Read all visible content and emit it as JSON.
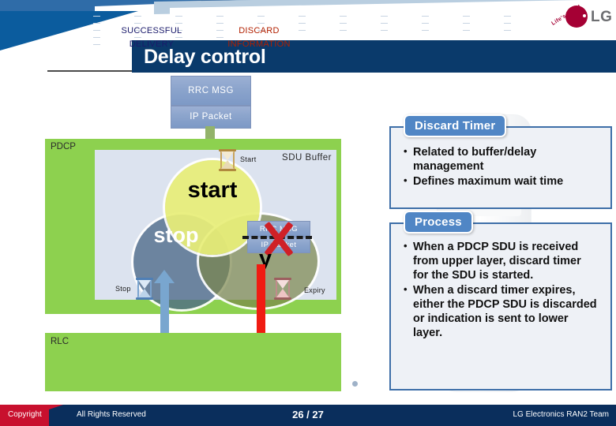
{
  "header": {
    "title": "Delay control",
    "logo": {
      "word": "LG",
      "tagline": "Life's Good"
    }
  },
  "diagram": {
    "input_boxes": [
      {
        "label": "RRC MSG"
      },
      {
        "label": "IP Packet"
      }
    ],
    "pdcp_label": "PDCP",
    "sdu_buffer_label": "SDU Buffer",
    "circles": [
      {
        "label": "start",
        "color": "#E7EE78"
      },
      {
        "label": "stop",
        "color": "#4D6988"
      },
      {
        "label": "y",
        "color": "#7A864B"
      }
    ],
    "timers": [
      {
        "label": "Start",
        "color": "#b08a3e"
      },
      {
        "label": "Stop",
        "color": "#4f7fb5"
      },
      {
        "label": "Expiry",
        "color": "#b06a6a"
      }
    ],
    "discarded_boxes": [
      {
        "label": "RRC MSG"
      },
      {
        "label": "IP Packet"
      }
    ],
    "rlc_label": "RLC",
    "outcomes": [
      {
        "line1": "SUCCESSFUL",
        "line2": "DELIVERY",
        "color": "#1a1a6b"
      },
      {
        "line1": "DISCARD",
        "line2": "INFORMATION",
        "color": "#b22000"
      }
    ]
  },
  "panels": [
    {
      "heading": "Discard Timer",
      "bullets": [
        "Related to buffer/delay management",
        "Defines maximum wait time"
      ]
    },
    {
      "heading": "Process",
      "bullets": [
        "When a PDCP SDU is received from upper layer, discard timer for the SDU is started.",
        "When a discard timer expires, either the PDCP SDU is discarded or indication is sent to lower layer."
      ]
    }
  ],
  "footer": {
    "copyright": "Copyright",
    "rights": "All Rights Reserved",
    "page": "26 / 27",
    "team": "LG Electronics RAN2 Team"
  }
}
